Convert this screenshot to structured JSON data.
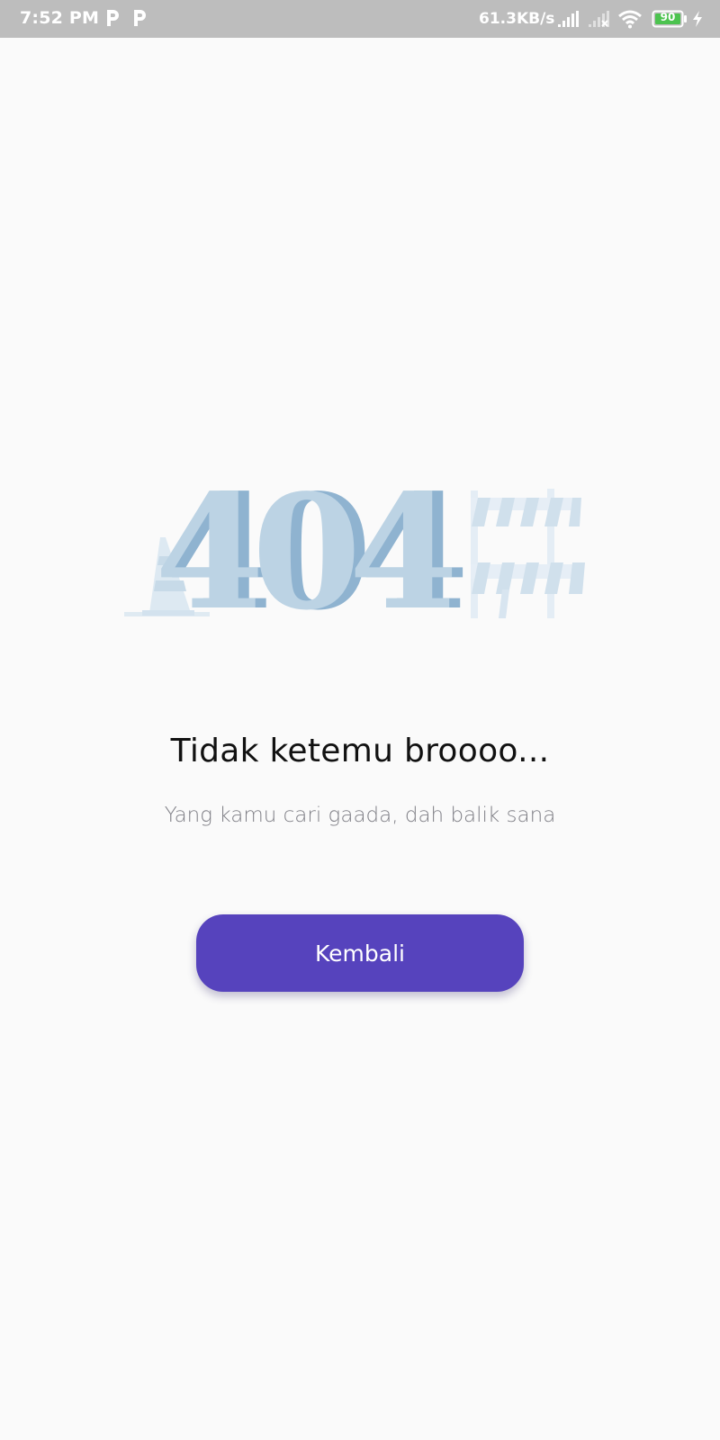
{
  "status_bar": {
    "time": "7:52 PM",
    "network_speed": "61.3KB/s",
    "battery_level": "90",
    "icons": [
      "p-notification-icon",
      "p-notification-icon",
      "signal-icon",
      "signal-no-service-icon",
      "wifi-icon",
      "battery-icon",
      "charging-bolt-icon"
    ]
  },
  "illustration": {
    "code": "404",
    "icons": [
      "traffic-cone-icon",
      "road-barrier-icon"
    ]
  },
  "main": {
    "title": "Tidak ketemu broooo...",
    "subtitle": "Yang kamu cari gaada, dah balik sana",
    "button_label": "Kembali"
  },
  "colors": {
    "status_bar": "#bdbdbd",
    "background": "#fafafa",
    "button": "#5643bd",
    "illustration_light": "#bcd3e4",
    "illustration_dark": "#8fb3d0",
    "battery": "#4cc34f"
  }
}
